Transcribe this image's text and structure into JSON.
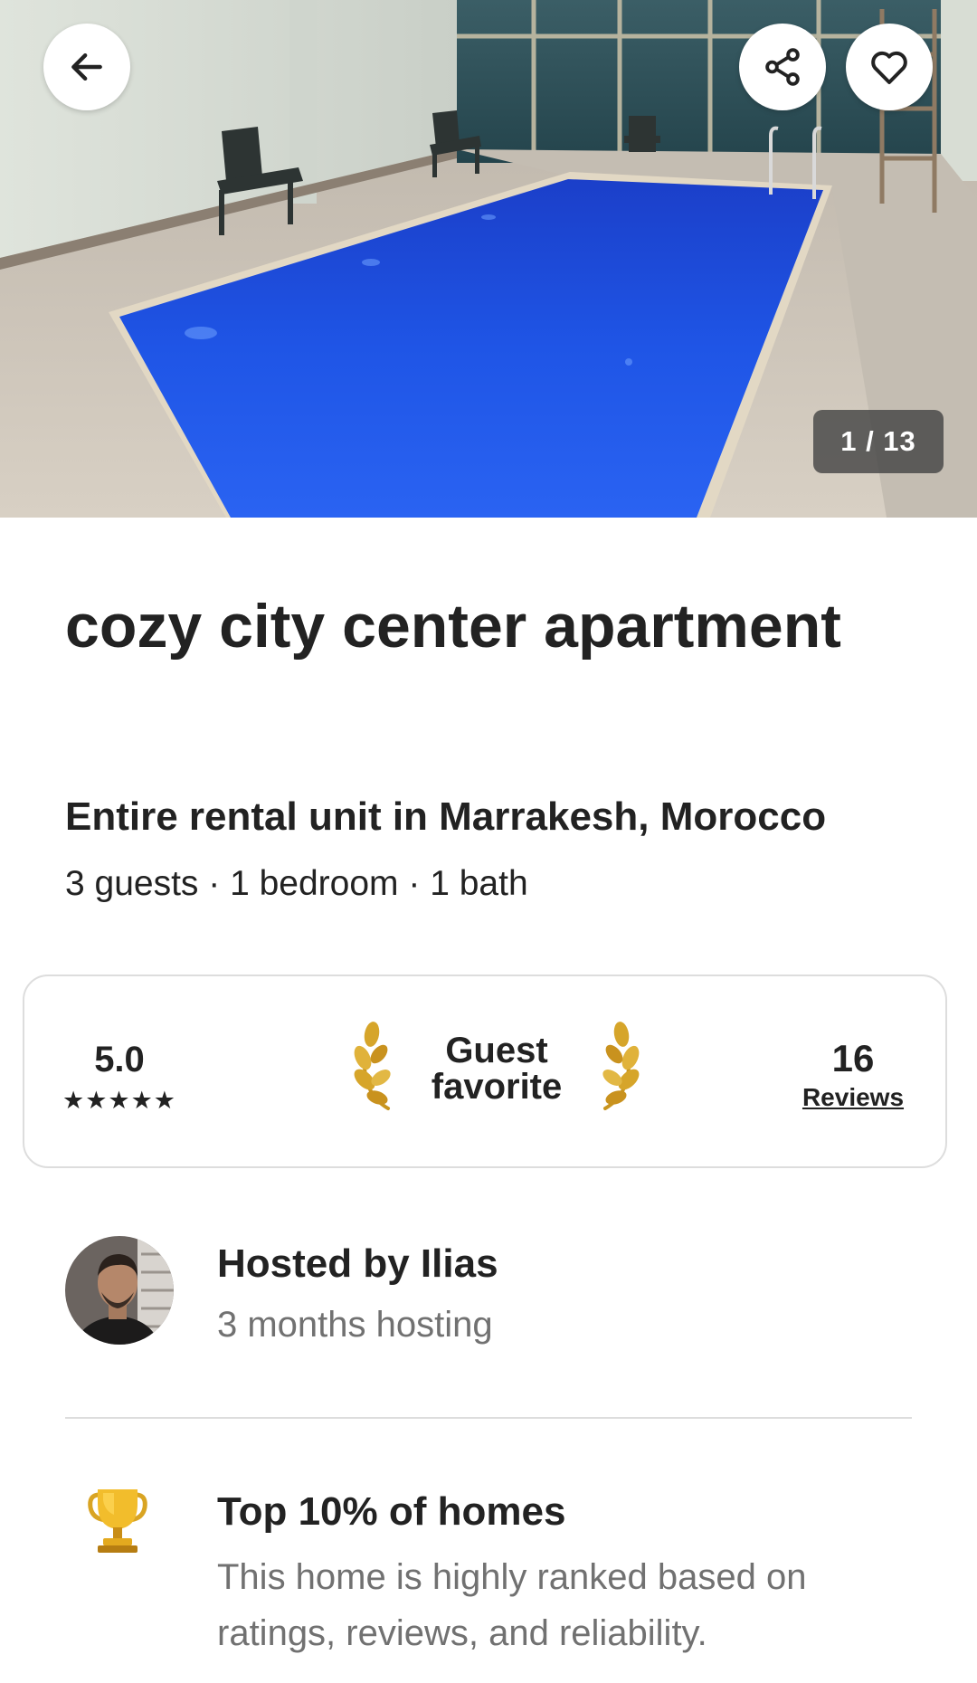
{
  "photo": {
    "counter": "1 / 13"
  },
  "toolbar": {
    "back_icon": "arrow-left-icon",
    "share_icon": "share-icon",
    "save_icon": "heart-outline-icon"
  },
  "listing": {
    "title": "cozy city center apartment",
    "type_location": "Entire rental unit in Marrakesh, Morocco",
    "details": "3 guests · 1 bedroom · 1 bath"
  },
  "rating_card": {
    "rating": "5.0",
    "stars": "★★★★★",
    "badge": "Guest favorite",
    "reviews_count": "16",
    "reviews_label": "Reviews"
  },
  "host": {
    "name": "Hosted by Ilias",
    "duration": "3 months hosting"
  },
  "highlight": {
    "icon": "trophy-icon",
    "title": "Top 10% of homes",
    "description": "This home is highly ranked based on ratings, reviews, and reliability."
  },
  "colors": {
    "text_primary": "#222222",
    "text_secondary": "#717171",
    "border": "#dddddd",
    "pool_blue": "#1f4fd8",
    "laurel_gold": "#d6a52a"
  }
}
